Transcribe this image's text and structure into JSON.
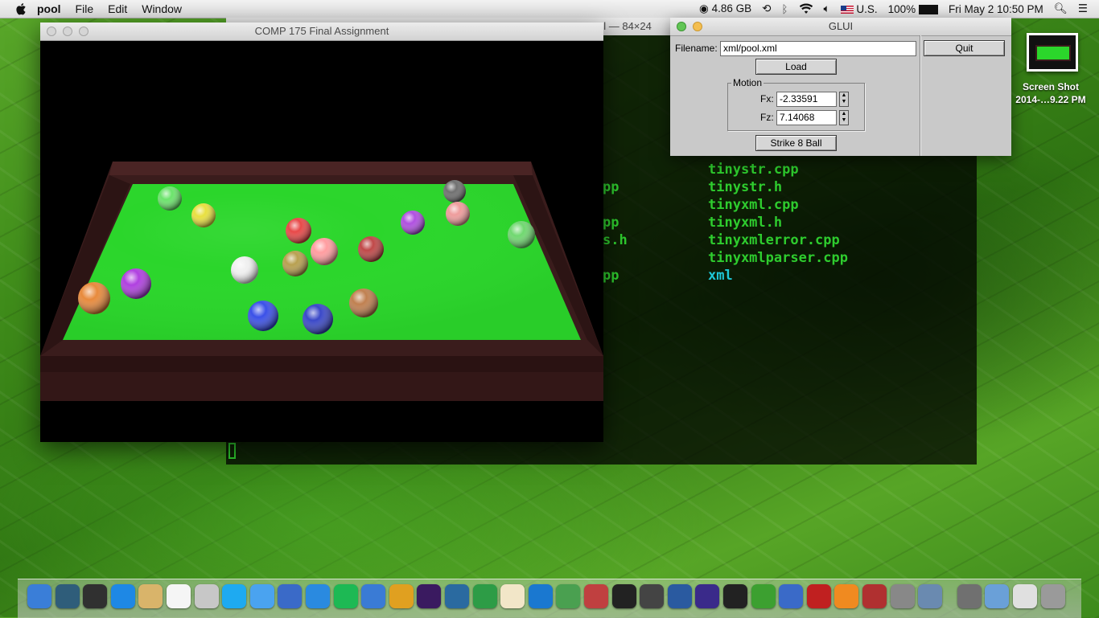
{
  "menubar": {
    "app": "pool",
    "items": [
      "File",
      "Edit",
      "Window"
    ],
    "memory": "4.86 GB",
    "input_source": "U.S.",
    "battery": "100%",
    "clock": "Fri May 2  10:50 PM"
  },
  "terminal": {
    "title_fragment": "ol — 84×24",
    "left_col": [
      "pp",
      "pp",
      "s.h",
      "pp"
    ],
    "right_col": [
      "tinystr.cpp",
      "tinystr.h",
      "tinyxml.cpp",
      "tinyxml.h",
      "tinyxmlerror.cpp",
      "tinyxmlparser.cpp",
      "xml"
    ]
  },
  "main_window": {
    "title": "COMP 175 Final Assignment",
    "balls": [
      {
        "color": "#6be46b"
      },
      {
        "color": "#e8e040"
      },
      {
        "color": "#e84848"
      },
      {
        "color": "#ff9da0"
      },
      {
        "color": "#c04848"
      },
      {
        "color": "#b050e0"
      },
      {
        "color": "#707070"
      },
      {
        "color": "#ee9c9c"
      },
      {
        "color": "#70d870"
      },
      {
        "color": "#f0f0f0"
      },
      {
        "color": "#b8a050"
      },
      {
        "color": "#e88a3c"
      },
      {
        "color": "#b040e0"
      },
      {
        "color": "#3a50e8"
      },
      {
        "color": "#3a48c8"
      },
      {
        "color": "#c08050"
      }
    ]
  },
  "glui": {
    "title": "GLUI",
    "filename_label": "Filename:",
    "filename_value": "xml/pool.xml",
    "quit_label": "Quit",
    "load_label": "Load",
    "motion_label": "Motion",
    "fx_label": "Fx:",
    "fx_value": "-2.33591",
    "fz_label": "Fz:",
    "fz_value": "7.14068",
    "strike_label": "Strike 8 Ball"
  },
  "desktop": {
    "screenshot_label_line1": "Screen Shot",
    "screenshot_label_line2": "2014-…9.22 PM"
  },
  "dock": {
    "icons": [
      "finder-icon",
      "time-machine-icon",
      "dashboard-icon",
      "app-store-icon",
      "contacts-icon",
      "calendar-icon",
      "preview-icon",
      "skype-icon",
      "messages-icon",
      "xcode-icon",
      "safari-icon",
      "spotify-icon",
      "itunes-icon",
      "garageband-icon",
      "imovie-icon",
      "iphoto-icon",
      "evernote-icon",
      "textedit-icon",
      "keynote-icon",
      "numbers-icon",
      "photo-booth-icon",
      "terminal-icon",
      "sublime-icon",
      "quicktime-icon",
      "eclipse-icon",
      "unity-icon",
      "unity-dev-icon",
      "xcode-tools-icon",
      "photo-album-icon",
      "ibooks-icon",
      "dictionary-icon",
      "system-prefs-icon",
      "preview-2-icon",
      "folder-icon",
      "downloads-icon",
      "documents-icon",
      "trash-icon"
    ],
    "colors": [
      "#3a7ed8",
      "#2f5d7a",
      "#303030",
      "#1e88e5",
      "#d9b46a",
      "#f5f5f5",
      "#c7c7c7",
      "#1eaaf1",
      "#4aa3f0",
      "#3a6ac8",
      "#2a8ae0",
      "#1db954",
      "#3a7bd5",
      "#e0a020",
      "#3a1a60",
      "#2a6aa0",
      "#2d9c46",
      "#f2e6c8",
      "#1a78d0",
      "#4aa050",
      "#c04040",
      "#222222",
      "#444444",
      "#2a5aa0",
      "#3a2a8a",
      "#222222",
      "#3ca030",
      "#3a6ac8",
      "#c02020",
      "#f08a20",
      "#b03030",
      "#888888",
      "#6a8ab0",
      "#707070",
      "#6aa0d8",
      "#e0e0e0",
      "#9a9a9a"
    ]
  }
}
